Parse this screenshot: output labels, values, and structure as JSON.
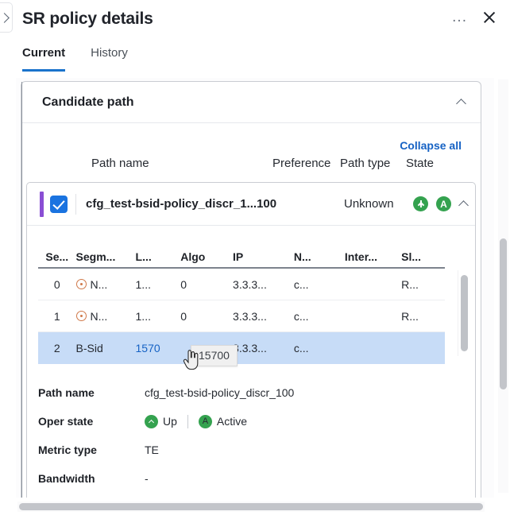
{
  "header": {
    "title": "SR policy details",
    "collapse_handle_icon": "chevron-right-icon",
    "more_label": "...",
    "close_icon": "close-icon"
  },
  "tabs": [
    {
      "label": "Current",
      "active": true
    },
    {
      "label": "History",
      "active": false
    }
  ],
  "card": {
    "title": "Candidate path",
    "collapse_icon": "chevron-up-icon",
    "collapse_all_label": "Collapse all"
  },
  "path_columns": {
    "name": "Path name",
    "preference": "Preference",
    "path_type": "Path type",
    "state": "State"
  },
  "path_item": {
    "checkbox_checked": true,
    "name": "cfg_test-bsid-policy_discr_1...100",
    "path_type": "Unknown",
    "status_up_icon": "arrow-up-badge",
    "status_active_icon": "active-badge",
    "collapse_icon": "chevron-up-icon",
    "accent_color": "#8a4ed4"
  },
  "segment_table": {
    "headers": [
      "Se...",
      "Segm...",
      "L...",
      "Algo",
      "IP",
      "N...",
      "Inter...",
      "Sl..."
    ],
    "rows": [
      {
        "index": "0",
        "segment_type": "N...",
        "segment_icon": "node-ring-icon",
        "label": "1...",
        "algo": "0",
        "ip": "3.3.3...",
        "node": "c...",
        "interface": "",
        "slice": "R...",
        "selected": false,
        "label_is_link": false
      },
      {
        "index": "1",
        "segment_type": "N...",
        "segment_icon": "node-ring-icon",
        "label": "1...",
        "algo": "0",
        "ip": "3.3.3...",
        "node": "c...",
        "interface": "",
        "slice": "R...",
        "selected": false,
        "label_is_link": false
      },
      {
        "index": "2",
        "segment_type": "B-Sid",
        "segment_icon": "",
        "label": "1570",
        "algo": "",
        "ip": "3.3.3...",
        "node": "c...",
        "interface": "",
        "slice": "",
        "selected": true,
        "label_is_link": true
      }
    ]
  },
  "tooltip": {
    "text": "15700",
    "cursor_icon": "pointer-hand-cursor"
  },
  "details": [
    {
      "label": "Path name",
      "value": "cfg_test-bsid-policy_discr_100",
      "type": "text"
    },
    {
      "label": "Oper state",
      "value": "Up",
      "value2": "Active",
      "type": "status"
    },
    {
      "label": "Metric type",
      "value": "TE",
      "type": "text"
    },
    {
      "label": "Bandwidth",
      "value": "-",
      "type": "text"
    }
  ],
  "colors": {
    "link": "#1662c4",
    "accent_purple": "#8a4ed4",
    "checkbox_blue": "#1a73e0",
    "status_green": "#34a24f",
    "row_selected": "#c7dcf7",
    "node_icon_orange": "#d0794a",
    "tab_underline": "#1a73cc"
  },
  "scrollbars": {
    "outer_vertical": "outer-vertical-scrollbar",
    "table_vertical": "table-vertical-scrollbar",
    "horizontal": "horizontal-scrollbar"
  }
}
